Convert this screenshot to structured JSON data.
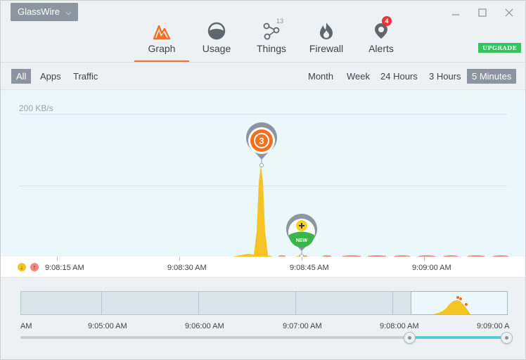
{
  "app": {
    "brand": "GlassWire",
    "brand_chevron": "⌵"
  },
  "window_controls": [
    "minimize",
    "maximize",
    "close"
  ],
  "nav": {
    "items": [
      {
        "label": "Graph",
        "icon": "graph-icon",
        "active": true
      },
      {
        "label": "Usage",
        "icon": "usage-icon"
      },
      {
        "label": "Things",
        "icon": "things-icon",
        "badge": "13"
      },
      {
        "label": "Firewall",
        "icon": "firewall-icon"
      },
      {
        "label": "Alerts",
        "icon": "alerts-icon",
        "badge": "4"
      }
    ],
    "upgrade": "UPGRADE"
  },
  "filters": {
    "left": [
      {
        "label": "All",
        "selected": true
      },
      {
        "label": "Apps"
      },
      {
        "label": "Traffic"
      }
    ],
    "right": [
      {
        "label": "Month"
      },
      {
        "label": "Week"
      },
      {
        "label": "24 Hours"
      },
      {
        "label": "3 Hours"
      },
      {
        "label": "5 Minutes",
        "selected": true
      }
    ]
  },
  "graph": {
    "y_label": "200 KB/s",
    "event_marker_count": "3",
    "new_marker_label": "NEW",
    "time_labels": [
      "9:08:15 AM",
      "9:08:30 AM",
      "9:08:45 AM",
      "9:09:00 AM"
    ],
    "legend": {
      "download": "↓",
      "upload": "↑"
    }
  },
  "overview": {
    "time_labels": [
      "AM",
      "9:05:00 AM",
      "9:06:00 AM",
      "9:07:00 AM",
      "9:08:00 AM",
      "9:09:00 A"
    ]
  },
  "colors": {
    "accent": "#f37021",
    "download": "#f6c325",
    "upload": "#f08a7a",
    "graph_bg": "#eaf8fc",
    "upgrade": "#34c65e",
    "alert_badge": "#e8343a",
    "selection": "#57cbd0"
  }
}
